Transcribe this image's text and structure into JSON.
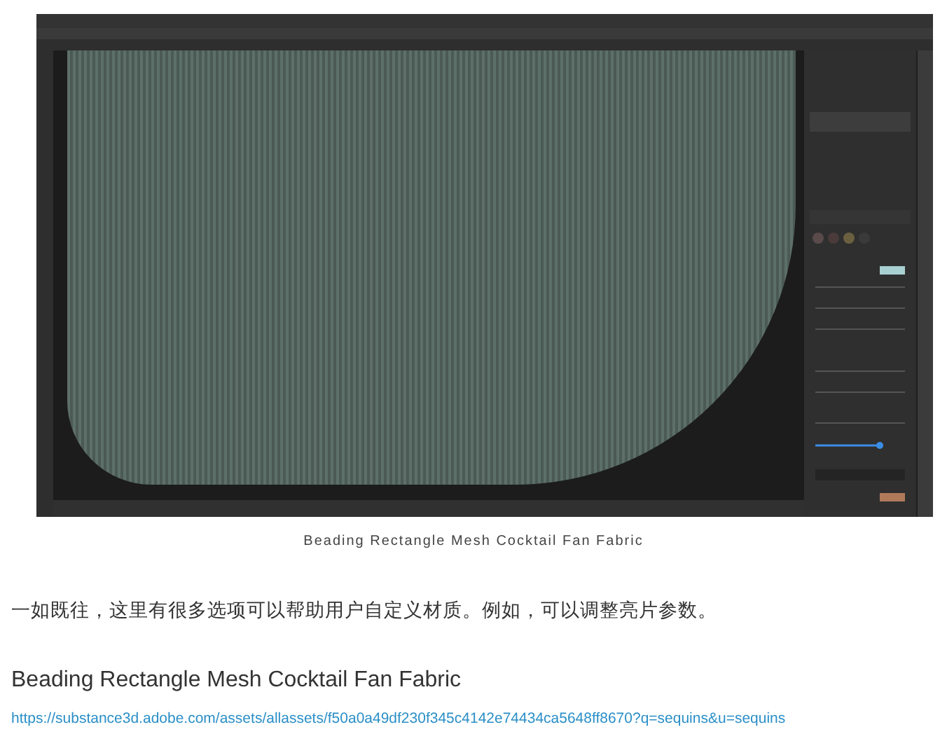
{
  "figure": {
    "caption": "Beading Rectangle Mesh Cocktail Fan Fabric"
  },
  "paragraph": "一如既往，这里有很多选项可以帮助用户自定义材质。例如，可以调整亮片参数。",
  "heading": "Beading Rectangle Mesh Cocktail Fan Fabric",
  "link": "https://substance3d.adobe.com/assets/allassets/f50a0a49df230f345c4142e74434ca5648ff8670?q=sequins&u=sequins"
}
